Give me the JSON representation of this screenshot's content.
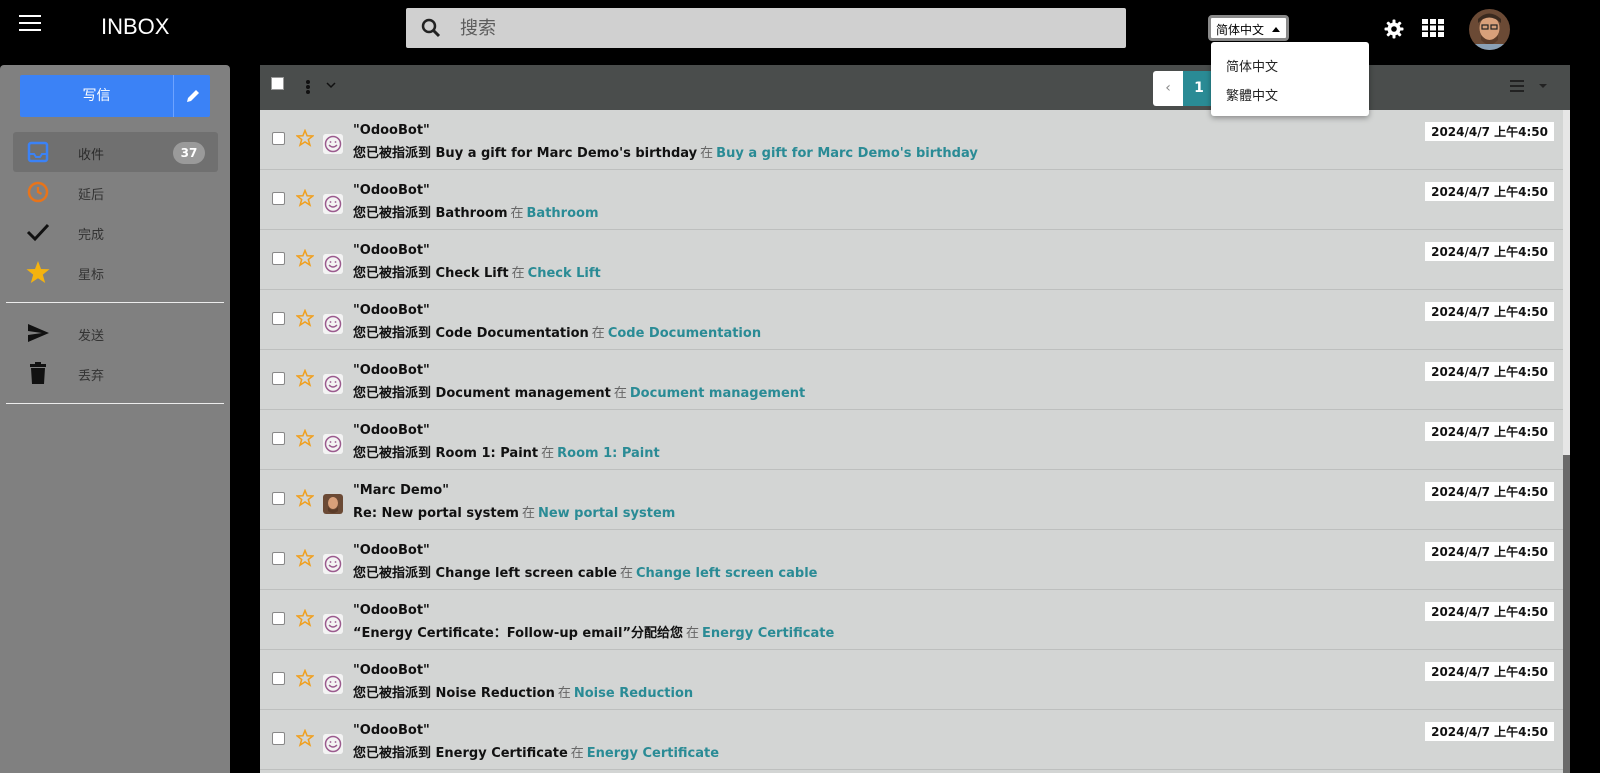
{
  "header": {
    "title": "INBOX",
    "search_placeholder": "搜索",
    "language_selected": "简体中文",
    "language_options": [
      "简体中文",
      "繁體中文"
    ]
  },
  "sidebar": {
    "compose_label": "写信",
    "items": [
      {
        "label": "收件",
        "icon": "inbox-icon",
        "badge": "37"
      },
      {
        "label": "延后",
        "icon": "clock-icon"
      },
      {
        "label": "完成",
        "icon": "checkmark-icon"
      },
      {
        "label": "星标",
        "icon": "star-icon"
      },
      {
        "label": "发送",
        "icon": "send-icon"
      },
      {
        "label": "丢弃",
        "icon": "trash-icon"
      }
    ]
  },
  "toolbar": {
    "prev_label": "‹",
    "current_page": "1"
  },
  "messages": [
    {
      "sender": "\"OdooBot\"",
      "subject": "您已被指派到 Buy a gift for Marc Demo's birthday",
      "in": "在",
      "link": "Buy a gift for Marc Demo's birthday",
      "date": "2024/4/7 上午4:50",
      "avatar": "odoobot"
    },
    {
      "sender": "\"OdooBot\"",
      "subject": "您已被指派到 Bathroom",
      "in": "在",
      "link": "Bathroom",
      "date": "2024/4/7 上午4:50",
      "avatar": "odoobot"
    },
    {
      "sender": "\"OdooBot\"",
      "subject": "您已被指派到 Check Lift",
      "in": "在",
      "link": "Check Lift",
      "date": "2024/4/7 上午4:50",
      "avatar": "odoobot"
    },
    {
      "sender": "\"OdooBot\"",
      "subject": "您已被指派到 Code Documentation",
      "in": "在",
      "link": "Code Documentation",
      "date": "2024/4/7 上午4:50",
      "avatar": "odoobot"
    },
    {
      "sender": "\"OdooBot\"",
      "subject": "您已被指派到 Document management",
      "in": "在",
      "link": "Document management",
      "date": "2024/4/7 上午4:50",
      "avatar": "odoobot"
    },
    {
      "sender": "\"OdooBot\"",
      "subject": "您已被指派到 Room 1: Paint",
      "in": "在",
      "link": "Room 1: Paint",
      "date": "2024/4/7 上午4:50",
      "avatar": "odoobot"
    },
    {
      "sender": "\"Marc Demo\"",
      "subject": "Re: New portal system",
      "in": "在",
      "link": "New portal system",
      "date": "2024/4/7 上午4:50",
      "avatar": "photo"
    },
    {
      "sender": "\"OdooBot\"",
      "subject": "您已被指派到 Change left screen cable",
      "in": "在",
      "link": "Change left screen cable",
      "date": "2024/4/7 上午4:50",
      "avatar": "odoobot"
    },
    {
      "sender": "\"OdooBot\"",
      "subject": "“Energy Certificate：Follow-up email”分配给您",
      "in": "在",
      "link": "Energy Certificate",
      "date": "2024/4/7 上午4:50",
      "avatar": "odoobot"
    },
    {
      "sender": "\"OdooBot\"",
      "subject": "您已被指派到 Noise Reduction",
      "in": "在",
      "link": "Noise Reduction",
      "date": "2024/4/7 上午4:50",
      "avatar": "odoobot"
    },
    {
      "sender": "\"OdooBot\"",
      "subject": "您已被指派到 Energy Certificate",
      "in": "在",
      "link": "Energy Certificate",
      "date": "2024/4/7 上午4:50",
      "avatar": "odoobot"
    }
  ],
  "colors": {
    "accent": "#3b82f6",
    "link": "#2a8b95",
    "star": "#f0a020",
    "snooze": "#e8741a"
  }
}
